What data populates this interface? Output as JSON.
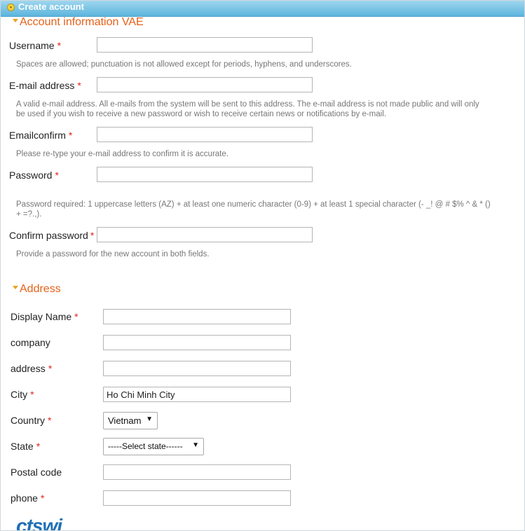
{
  "window": {
    "title": "Create account"
  },
  "account": {
    "legend": "Account information VAE",
    "username": {
      "label": "Username",
      "value": "",
      "help": "Spaces are allowed; punctuation is not allowed except for periods, hyphens, and underscores."
    },
    "email": {
      "label": "E-mail address",
      "value": "",
      "help_line1": "A valid e-mail address. All e-mails from the system will be sent to this address. The e-mail address is not made public and will only",
      "help_line2": "be used if you wish to receive a new password or wish to receive certain news or notifications by e-mail."
    },
    "email_confirm": {
      "label": "Emailconfirm",
      "value": "",
      "help": "Please re-type your e-mail address to confirm it is accurate."
    },
    "password": {
      "label": "Password",
      "value": "",
      "help_line1": "Password required: 1 uppercase letters (AZ) + at least one numeric character (0-9) + at least 1 special character (- _! @ # $% ^ & * ()",
      "help_line2": "+ =?.,)."
    },
    "confirm_password": {
      "label": "Confirm password",
      "value": "",
      "help": "Provide a password for the new account in both fields."
    }
  },
  "address": {
    "legend": "Address",
    "display_name": {
      "label": "Display Name",
      "value": ""
    },
    "company": {
      "label": "company",
      "value": ""
    },
    "address": {
      "label": "address",
      "value": ""
    },
    "city": {
      "label": "City",
      "value": "Ho Chi Minh City"
    },
    "country": {
      "label": "Country",
      "selected": "Vietnam"
    },
    "state": {
      "label": "State",
      "selected": "-----Select state------"
    },
    "postal_code": {
      "label": "Postal code",
      "value": ""
    },
    "phone": {
      "label": "phone",
      "value": ""
    }
  },
  "required_marker": "*",
  "logo_text": "ctswi",
  "colors": {
    "title_bar": "#5cb5dd",
    "legend": "#e4621a",
    "required": "#e3241c",
    "help_text": "#777777"
  },
  "icons": {
    "title": "info-circle-icon",
    "legend_toggle": "triangle-down-icon",
    "select": "caret-down-icon"
  }
}
